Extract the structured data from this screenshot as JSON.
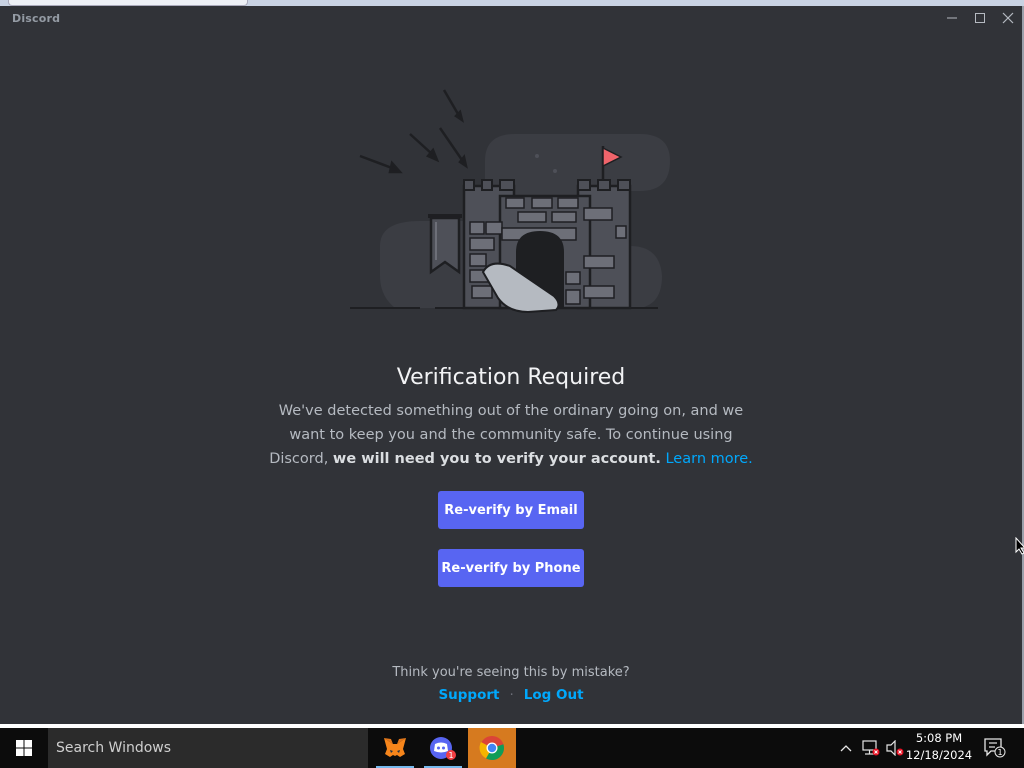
{
  "window": {
    "app_title": "Discord"
  },
  "verification": {
    "heading": "Verification Required",
    "desc_part1": "We've detected something out of the ordinary going on, and we want to keep you and the community safe. To continue using Discord, ",
    "desc_bold": "we will need you to verify your account.",
    "learn_more": "Learn more.",
    "email_button": "Re-verify by Email",
    "phone_button": "Re-verify by Phone",
    "mistake_text": "Think you're seeing this by mistake?",
    "support_link": "Support",
    "separator": "·",
    "logout_link": "Log Out"
  },
  "taskbar": {
    "search_placeholder": "Search Windows",
    "time": "5:08 PM",
    "date": "12/18/2024",
    "notification_count": "1",
    "discord_badge": "1",
    "apps": [
      "metamask-icon",
      "discord-icon",
      "chrome-icon"
    ]
  },
  "colors": {
    "background": "#313338",
    "button": "#5865f2",
    "link": "#00a8fc",
    "flag": "#f0646b"
  }
}
